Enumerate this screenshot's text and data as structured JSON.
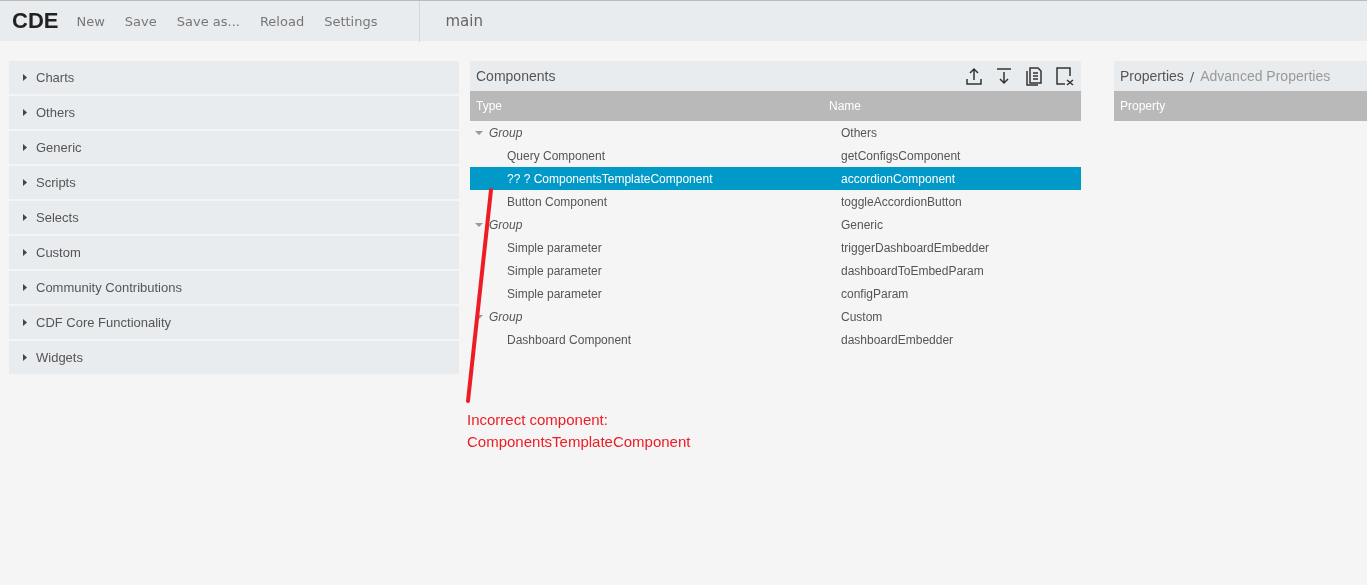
{
  "logo": "CDE",
  "menu": [
    {
      "label": "New"
    },
    {
      "label": "Save"
    },
    {
      "label": "Save as..."
    },
    {
      "label": "Reload"
    },
    {
      "label": "Settings"
    }
  ],
  "dashboard_title": "main",
  "palette": [
    {
      "label": "Charts",
      "expanded": false
    },
    {
      "label": "Others",
      "expanded": false
    },
    {
      "label": "Generic",
      "expanded": false
    },
    {
      "label": "Scripts",
      "expanded": false
    },
    {
      "label": "Selects",
      "expanded": false
    },
    {
      "label": "Custom",
      "expanded": false
    },
    {
      "label": "Community Contributions",
      "expanded": false
    },
    {
      "label": "CDF Core Functionality",
      "expanded": false
    },
    {
      "label": "Widgets",
      "expanded": false
    }
  ],
  "components": {
    "title": "Components",
    "columns": [
      "Type",
      "Name"
    ],
    "groups": [
      {
        "type": "Group",
        "name": "Others",
        "expanded": true,
        "children": [
          {
            "type": "Query Component",
            "name": "getConfigsComponent",
            "selected": false
          },
          {
            "type": "?? ? ComponentsTemplateComponent",
            "name": "accordionComponent",
            "selected": true
          },
          {
            "type": "Button Component",
            "name": "toggleAccordionButton",
            "selected": false
          }
        ]
      },
      {
        "type": "Group",
        "name": "Generic",
        "expanded": true,
        "children": [
          {
            "type": "Simple parameter",
            "name": "triggerDashboardEmbedder",
            "selected": false
          },
          {
            "type": "Simple parameter",
            "name": "dashboardToEmbedParam",
            "selected": false
          },
          {
            "type": "Simple parameter",
            "name": "configParam",
            "selected": false
          }
        ]
      },
      {
        "type": "Group",
        "name": "Custom",
        "expanded": true,
        "children": [
          {
            "type": "Dashboard Component",
            "name": "dashboardEmbedder",
            "selected": false
          }
        ]
      }
    ]
  },
  "annotation": {
    "lines": [
      "Incorrect component:",
      "ComponentsTemplateComponent"
    ]
  },
  "properties": {
    "tabs": [
      {
        "label": "Properties",
        "selected": true
      },
      {
        "label": "Advanced Properties",
        "selected": false
      }
    ],
    "separator": "/",
    "columns": [
      "Property"
    ]
  }
}
